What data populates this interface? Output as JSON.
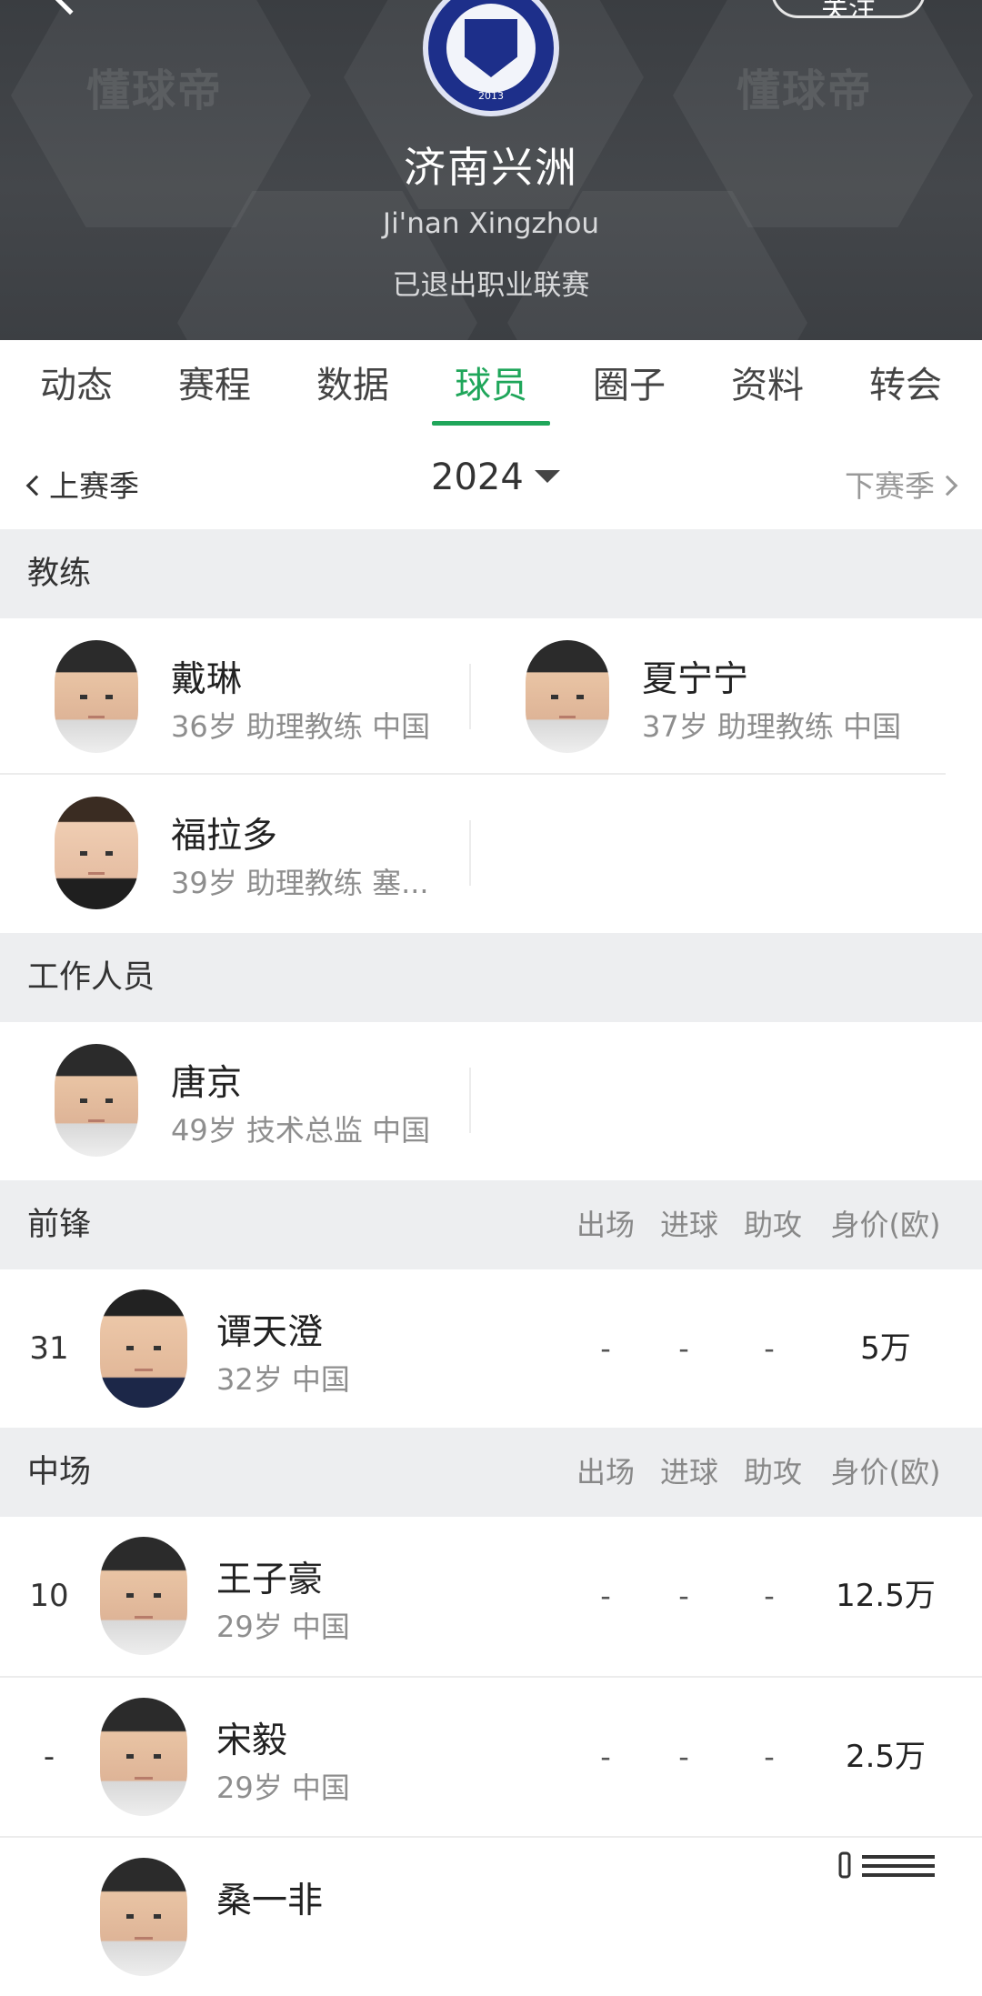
{
  "header": {
    "watermark": "懂球帝",
    "follow_label": "关注",
    "team_name": "济南兴洲",
    "team_name_en": "Ji'nan Xingzhou",
    "status": "已退出职业联赛",
    "logo_year": "2013"
  },
  "tabs": [
    {
      "label": "动态"
    },
    {
      "label": "赛程"
    },
    {
      "label": "数据"
    },
    {
      "label": "球员",
      "active": true
    },
    {
      "label": "圈子"
    },
    {
      "label": "资料"
    },
    {
      "label": "转会"
    }
  ],
  "season": {
    "prev_label": "上赛季",
    "year": "2024",
    "next_label": "下赛季"
  },
  "coaches": {
    "title": "教练",
    "people": [
      {
        "name": "戴琳",
        "info": "36岁 助理教练 中国"
      },
      {
        "name": "夏宁宁",
        "info": "37岁 助理教练 中国"
      },
      {
        "name": "福拉多",
        "info": "39岁 助理教练 塞..."
      }
    ]
  },
  "staff": {
    "title": "工作人员",
    "people": [
      {
        "name": "唐京",
        "info": "49岁 技术总监 中国"
      }
    ]
  },
  "columns": [
    "出场",
    "进球",
    "助攻",
    "身价(欧)"
  ],
  "forwards": {
    "title": "前锋",
    "players": [
      {
        "number": "31",
        "name": "谭天澄",
        "info": "32岁 中国",
        "apps": "-",
        "goals": "-",
        "assists": "-",
        "value": "5万"
      }
    ]
  },
  "midfielders": {
    "title": "中场",
    "players": [
      {
        "number": "10",
        "name": "王子豪",
        "info": "29岁 中国",
        "apps": "-",
        "goals": "-",
        "assists": "-",
        "value": "12.5万"
      },
      {
        "number": "-",
        "name": "宋毅",
        "info": "29岁 中国",
        "apps": "-",
        "goals": "-",
        "assists": "-",
        "value": "2.5万"
      },
      {
        "number": "",
        "name": "桑一非",
        "info": "",
        "apps": "",
        "goals": "",
        "assists": "",
        "value": ""
      }
    ]
  },
  "colors": {
    "accent_green": "#1fa65a",
    "header_bg": "#404347",
    "section_bg": "#edeef0",
    "logo_blue": "#1d2f8a"
  }
}
